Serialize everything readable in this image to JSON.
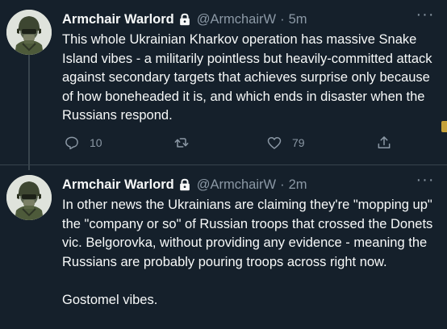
{
  "tweets": [
    {
      "author": "Armchair Warlord",
      "handle": "@ArmchairW",
      "separator": "·",
      "time": "5m",
      "text": "This whole Ukrainian Kharkov operation has massive Snake Island vibes - a militarily pointless but heavily-committed attack against secondary targets that achieves surprise only because of how boneheaded it is, and which ends in disaster when the Russians respond.",
      "more": "···",
      "replies": "10",
      "likes": "79"
    },
    {
      "author": "Armchair Warlord",
      "handle": "@ArmchairW",
      "separator": "·",
      "time": "2m",
      "text_lines": [
        "In other news the Ukrainians are claiming they're \"mopping up\" the \"company or so\" of Russian troops that crossed the Donets vic. Belgorovka, without providing any evidence - meaning the Russians are probably pouring troops across right now.",
        "Gostomel vibes."
      ],
      "more": "···"
    }
  ],
  "icons": {
    "lock": "lock-icon",
    "reply": "reply-icon",
    "retweet": "retweet-icon",
    "like": "heart-icon",
    "share": "share-icon",
    "more": "more-icon"
  },
  "colors": {
    "background": "#15202b",
    "text": "#f7f9f9",
    "muted": "#8b98a5",
    "divider": "#38444d"
  }
}
